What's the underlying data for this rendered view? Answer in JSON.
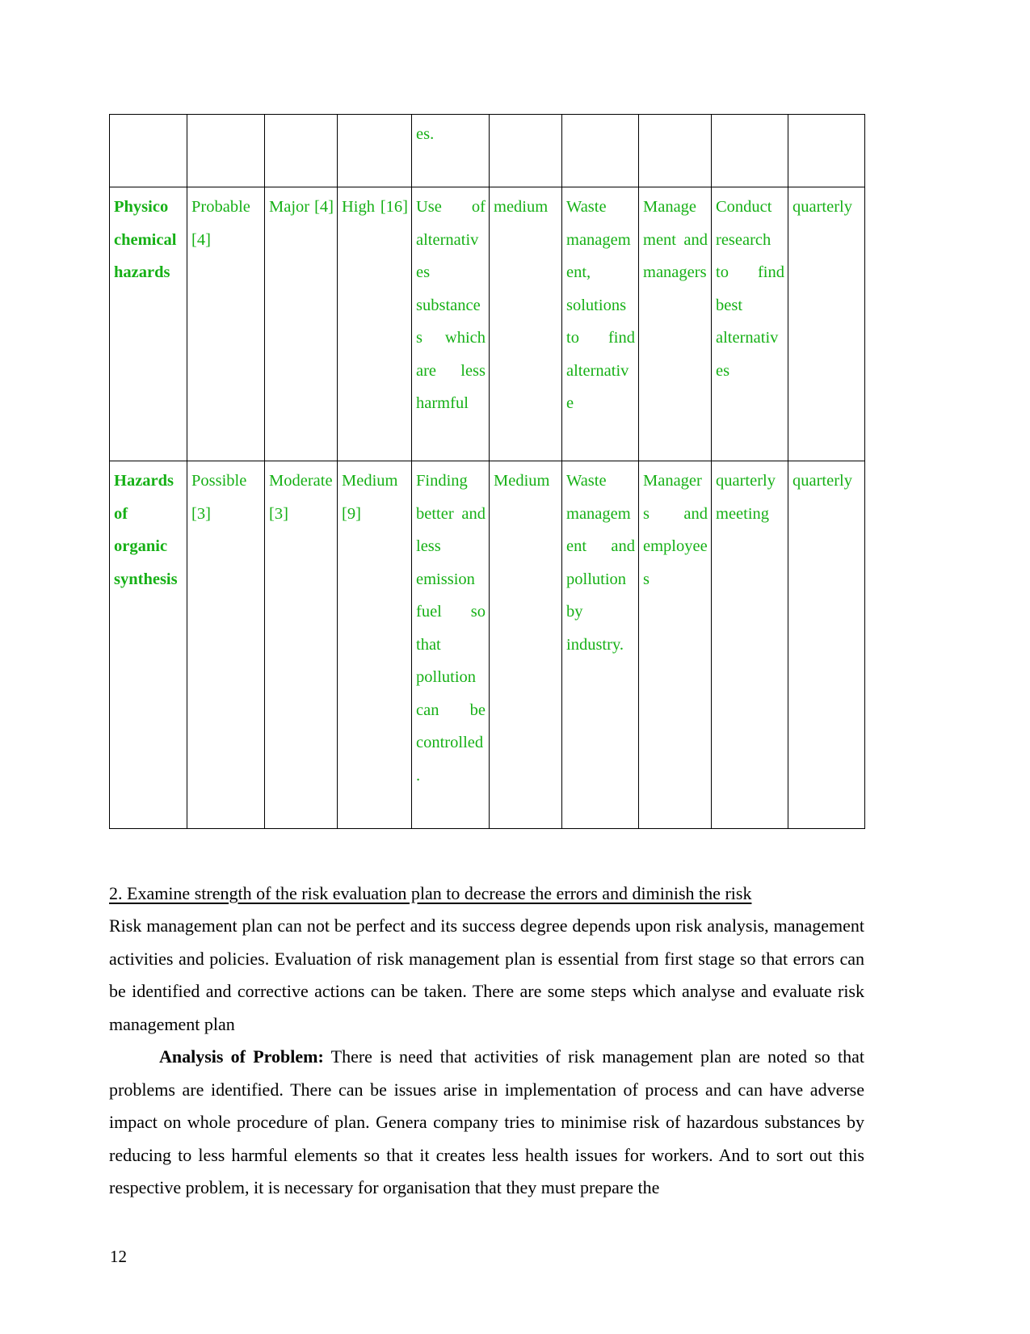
{
  "document": {
    "page_number": "12",
    "table_text_color": "#16b016",
    "body_text_color": "#000000"
  },
  "table": {
    "columns": 10,
    "rows": [
      {
        "id": "row-partial",
        "cells": [
          "",
          "",
          "",
          "",
          "es.",
          "",
          "",
          "",
          "",
          ""
        ],
        "bold_first": false
      },
      {
        "id": "row-physicochemical",
        "cells": [
          "Physico chemical hazards",
          "Probable [4]",
          "Major [4]",
          "High [16]",
          "Use of alternatives substances which are less harmful",
          "medium",
          "Waste management, solutions to find alternative",
          "Management and managers",
          "Conduct research to find best alternatives",
          "quarterly"
        ],
        "bold_first": true
      },
      {
        "id": "row-organic-synthesis",
        "cells": [
          "Hazards of organic synthesis",
          "Possible [3]",
          "Moderate [3]",
          "Medium [9]",
          "Finding better and less emission fuel so that pollution can be controlled.",
          "Medium",
          "Waste management and pollution by industry.",
          "Managers and employees",
          "quarterly meeting",
          "quarterly"
        ],
        "bold_first": true
      }
    ]
  },
  "body": {
    "heading": "2. Examine strength of the risk evaluation plan to decrease the errors and diminish the risk",
    "paragraph_1": "Risk management plan can not be perfect and its success degree depends upon risk analysis, management activities and policies. Evaluation of risk management plan is essential from first stage so that errors can be identified and corrective actions can be taken. There are some steps which analyse and evaluate risk management plan",
    "paragraph_2_lead": "Analysis of Problem:",
    "paragraph_2_rest": " There is need that activities of risk management plan are noted so that problems are identified. There can be issues arise in implementation of process and can have adverse impact on whole procedure of plan. Genera company tries to minimise risk of hazardous substances by reducing to less harmful elements so that it creates less health issues for workers. And to sort out this respective problem, it is necessary for organisation that they must prepare the"
  }
}
